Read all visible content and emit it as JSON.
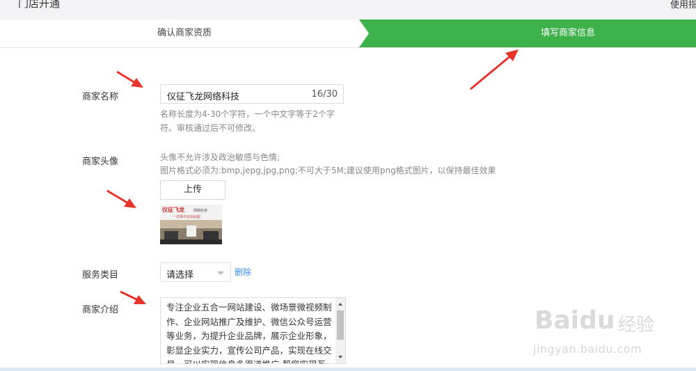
{
  "header": {
    "title": "门店开通",
    "help_link": "使用指"
  },
  "steps": [
    {
      "label": "确认商家资质",
      "active": false
    },
    {
      "label": "填写商家信息",
      "active": true
    }
  ],
  "form": {
    "name": {
      "label": "商家名称",
      "value": "仪征飞龙网络科技",
      "counter": "16/30",
      "hint_line1": "名称长度为4-30个字符，一个中文字等于2个字",
      "hint_line2": "符。审核通过后不可修改。"
    },
    "avatar": {
      "label": "商家头像",
      "hint_line1": "头像不允许涉及政治敏感与色情;",
      "hint_line2": "图片格式必须为:bmp,jepg,jpg,png;不可大于5M;建议使用png格式图片，以保持最佳效果",
      "upload_label": "上传",
      "image": {
        "logo_text": "仪征飞龙",
        "company_text": "网络科技",
        "slogan": "一切事中云由此起"
      }
    },
    "category": {
      "label": "服务类目",
      "selected": "请选择",
      "delete_label": "删除"
    },
    "intro": {
      "label": "商家介绍",
      "lines": [
        "专注企业五合一网站建设、微场景微视频制",
        "作、企业网站推广及维护、微信公众号运营",
        "等业务，为提升企业品牌，展示企业形象，",
        "彰显企业实力，宣传公司产品，实现在线交",
        "易，可以实现信息多渠道推广,帮您实现互联"
      ]
    }
  },
  "watermark": {
    "brand": "Baidu",
    "cn": "经验",
    "url": "jingyan.baidu.com"
  },
  "colors": {
    "step_active": "#3db24a",
    "arrow": "#e8332b",
    "link": "#3a8ee6"
  }
}
